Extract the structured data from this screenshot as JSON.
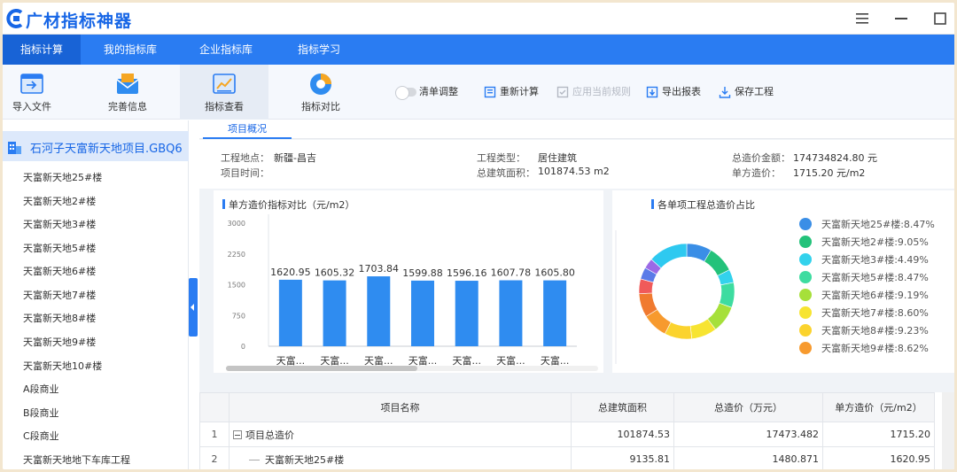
{
  "app": {
    "title": "广材指标神器"
  },
  "nav": {
    "tabs": [
      {
        "label": "指标计算",
        "active": true
      },
      {
        "label": "我的指标库"
      },
      {
        "label": "企业指标库"
      },
      {
        "label": "指标学习"
      }
    ]
  },
  "toolbar": {
    "buttons": [
      {
        "label": "导入文件",
        "icon": "import-file-icon"
      },
      {
        "label": "完善信息",
        "icon": "envelope-icon"
      },
      {
        "label": "指标查看",
        "icon": "chart-view-icon",
        "active": true
      },
      {
        "label": "指标对比",
        "icon": "pie-chart-icon"
      }
    ],
    "actions": [
      {
        "label": "清单调整",
        "icon": "toggle"
      },
      {
        "label": "重新计算",
        "icon": "recalc-icon"
      },
      {
        "label": "应用当前规则",
        "icon": "apply-rule-icon",
        "disabled": true
      },
      {
        "label": "导出报表",
        "icon": "export-icon"
      },
      {
        "label": "保存工程",
        "icon": "save-icon"
      }
    ]
  },
  "sidebar": {
    "project": "石河子天富新天地项目.GBQ6",
    "items": [
      "天富新天地25#楼",
      "天富新天地2#楼",
      "天富新天地3#楼",
      "天富新天地5#楼",
      "天富新天地6#楼",
      "天富新天地7#楼",
      "天富新天地8#楼",
      "天富新天地9#楼",
      "天富新天地10#楼",
      "A段商业",
      "B段商业",
      "C段商业",
      "天富新天地地下车库工程"
    ]
  },
  "content": {
    "tab": "项目概况",
    "info": {
      "location_label": "工程地点：",
      "location": "新疆-昌吉",
      "time_label": "项目时间：",
      "type_label": "工程类型：",
      "type": "居住建筑",
      "area_label": "总建筑面积：",
      "area": "101874.53 m2",
      "total_label": "总造价金额：",
      "total": "174734824.80 元",
      "unit_label": "单方造价：",
      "unit": "1715.20 元/m2"
    }
  },
  "chart_data": [
    {
      "type": "bar",
      "title": "单方造价指标对比（元/m2）",
      "categories": [
        "天富...",
        "天富...",
        "天富...",
        "天富...",
        "天富...",
        "天富...",
        "天富..."
      ],
      "values": [
        1620.95,
        1605.32,
        1703.84,
        1599.88,
        1596.16,
        1607.78,
        1605.8
      ],
      "yticks": [
        "3000",
        "2250",
        "1500",
        "750",
        "0"
      ],
      "ylim": [
        0,
        3000
      ],
      "color": "#2f8cf0"
    },
    {
      "type": "pie",
      "title": "各单项工程总造价占比",
      "legend": [
        {
          "label": "天富新天地25#楼:8.47%",
          "value": 8.47,
          "color": "#3a8ee6"
        },
        {
          "label": "天富新天地2#楼:9.05%",
          "value": 9.05,
          "color": "#23c27a"
        },
        {
          "label": "天富新天地3#楼:4.49%",
          "value": 4.49,
          "color": "#33d2ec"
        },
        {
          "label": "天富新天地5#楼:8.47%",
          "value": 8.47,
          "color": "#3ddca0"
        },
        {
          "label": "天富新天地6#楼:9.19%",
          "value": 9.19,
          "color": "#a6e03a"
        },
        {
          "label": "天富新天地7#楼:8.60%",
          "value": 8.6,
          "color": "#f7e431"
        },
        {
          "label": "天富新天地8#楼:9.23%",
          "value": 9.23,
          "color": "#fbd32d"
        },
        {
          "label": "天富新天地9#楼:8.62%",
          "value": 8.62,
          "color": "#f79a2e"
        }
      ],
      "extra_segments": [
        {
          "value": 8.0,
          "color": "#f07a30"
        },
        {
          "value": 5.0,
          "color": "#f05a5a"
        },
        {
          "value": 4.0,
          "color": "#5b7be8"
        },
        {
          "value": 3.5,
          "color": "#9b6ae6"
        },
        {
          "value": 13.28,
          "color": "#2ec9f0"
        }
      ]
    }
  ],
  "table": {
    "headers": [
      "",
      "项目名称",
      "总建筑面积",
      "总造价（万元）",
      "单方造价（元/m2）"
    ],
    "rows": [
      {
        "idx": "1",
        "name": "项目总造价",
        "area": "101874.53",
        "total": "17473.482",
        "unit": "1715.20"
      },
      {
        "idx": "2",
        "name": "天富新天地25#楼",
        "area": "9135.81",
        "total": "1480.871",
        "unit": "1620.95"
      }
    ]
  }
}
